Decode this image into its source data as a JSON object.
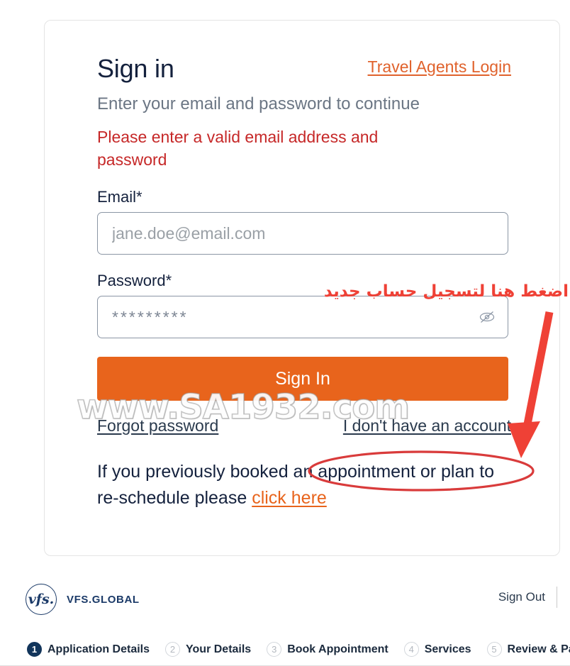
{
  "card": {
    "title": "Sign in",
    "travel_agents_link": "Travel Agents Login",
    "subtitle": "Enter your email and password to continue",
    "error_message": "Please enter a valid email address and password",
    "email_label": "Email*",
    "email_placeholder": "jane.doe@email.com",
    "email_value": "",
    "password_label": "Password*",
    "password_value": "*********",
    "password_toggle_icon": "eye-slash-icon",
    "signin_button": "Sign In",
    "forgot_password_link": "Forgot password",
    "no_account_link": "I don't have an account",
    "reschedule_text_prefix": "If you previously booked an appointment or plan to re-schedule please ",
    "reschedule_link": "click here"
  },
  "watermark": {
    "text": "www.SA1932.com"
  },
  "annotation": {
    "arabic_note": "اضغط هنا لتسجيل حساب جديد",
    "arrow": "red-down-arrow",
    "ellipse": "red-ellipse-highlight",
    "color": "#ef4136"
  },
  "footer": {
    "logo_mark": "vfs.",
    "logo_text": "VFS.GLOBAL",
    "sign_out": "Sign Out"
  },
  "steps": [
    {
      "num": "1",
      "label": "Application Details",
      "active": true
    },
    {
      "num": "2",
      "label": "Your Details",
      "active": false
    },
    {
      "num": "3",
      "label": "Book Appointment",
      "active": false
    },
    {
      "num": "4",
      "label": "Services",
      "active": false
    },
    {
      "num": "5",
      "label": "Review & Pay",
      "active": false
    }
  ],
  "colors": {
    "accent_orange": "#e8641c",
    "link_orange": "#e0622c",
    "error_red": "#c62828",
    "annotation_red": "#ef4136",
    "navy": "#12355b"
  }
}
